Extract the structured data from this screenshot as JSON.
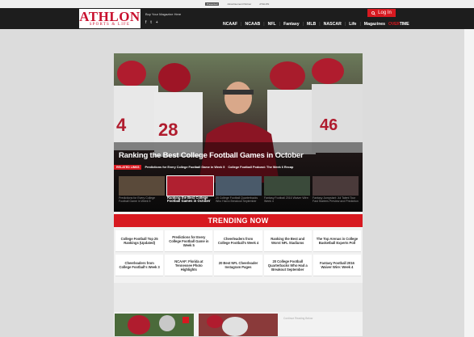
{
  "adstrip": {
    "left_label": "Presented",
    "mid_label": "Advertisement Partner",
    "right_label": "ATHLON"
  },
  "header": {
    "logo_main": "ATHLON",
    "logo_sub": "SPORTS & LIFE",
    "buy_magazine": "Buy Your Magazine Here",
    "social": [
      "f",
      "t",
      "+"
    ],
    "login_label": "Log In",
    "nav": [
      "NCAAF",
      "NCAAB",
      "NFL",
      "Fantasy",
      "MLB",
      "NASCAR",
      "Life",
      "Magazines"
    ],
    "overtime_part1": "OVER",
    "overtime_part2": "TIME"
  },
  "hero": {
    "title": "Ranking the Best College Football Games in October",
    "related_tag": "RELATED LINKS",
    "related_links": [
      "Predictions for Every College Football Game in Week 5",
      "College Football Podcast: The Week 6 Recap"
    ]
  },
  "thumbs": [
    {
      "caption": "Predictions for Every College Football Game in Week 5",
      "active": false
    },
    {
      "caption": "Ranking the Best College Football Games in October",
      "active": true
    },
    {
      "caption": "20 College Football Quarterbacks Who Had a Breakout September",
      "active": false
    },
    {
      "caption": "Fantasy Football 2016 Waiver Wire: Week 4",
      "active": false
    },
    {
      "caption": "Fantasy Jumpstart: Jul Talent Tour Fast Starters Preview and Prediction",
      "active": false
    }
  ],
  "trending": {
    "title": "TRENDING NOW",
    "items": [
      "College Football Top 25 Rankings (Updated)",
      "Predictions for Every College Football Game in Week 5",
      "Cheerleaders from College Football's Week 4",
      "Ranking the Best and Worst NFL Stadiums",
      "The Top Arenas in College Basketball Experts Poll",
      "Cheerleaders from College Football's Week 3",
      "NCAAF: Florida at Tennessee Photo Highlights",
      "20 Best NFL Cheerleader Instagram Pages",
      "20 College Football Quarterbacks Who Had a Breakout September",
      "Fantasy Football 2016 Waiver Wire: Week 4"
    ]
  },
  "continue_reading": "Continue Reading Below",
  "colors": {
    "accent": "#d71920",
    "header_bg": "#1d1d1d",
    "page_bg": "#dcdcdc"
  }
}
